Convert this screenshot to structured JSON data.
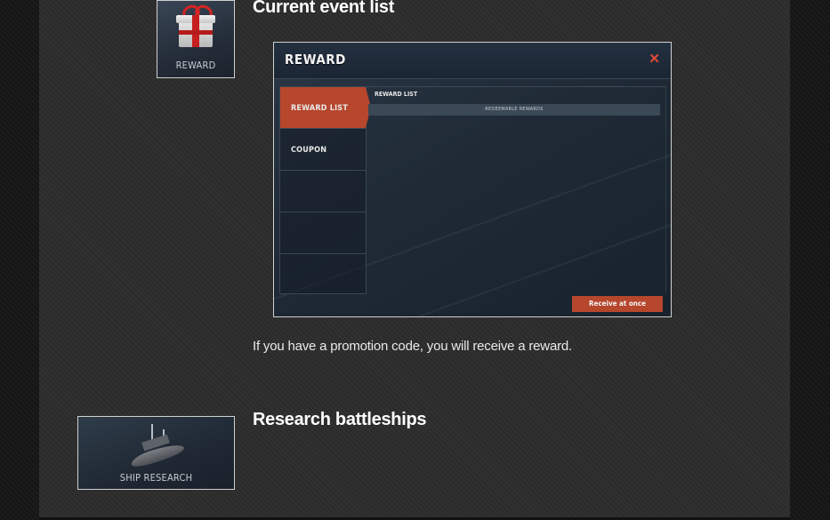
{
  "sections": {
    "event": {
      "tile_label": "REWARD",
      "heading": "Current event list",
      "description": "If you have a promotion code, you will receive a reward."
    },
    "research": {
      "tile_label": "SHIP RESEARCH",
      "heading": "Research battleships"
    }
  },
  "screenshot": {
    "title": "REWARD",
    "close_icon": "close-icon",
    "menu": [
      {
        "label": "REWARD LIST",
        "active": true
      },
      {
        "label": "COUPON",
        "active": false
      },
      {
        "label": "",
        "active": false
      },
      {
        "label": "",
        "active": false
      },
      {
        "label": "",
        "active": false
      }
    ],
    "list_label": "REWARD LIST",
    "list_row": "REDEEMABLE REWARDS",
    "receive_button": "Receive at once"
  },
  "colors": {
    "accent": "#b6462c",
    "close": "#e14a36",
    "panel": "#1f2a36"
  }
}
